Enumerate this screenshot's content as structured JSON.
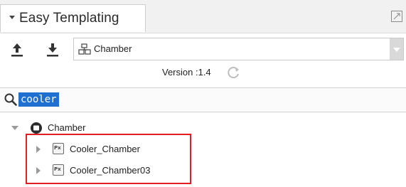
{
  "panel": {
    "tab_title": "Easy Templating"
  },
  "toolbar": {
    "selected_component": "Chamber"
  },
  "version": {
    "text": "Version :1.4"
  },
  "search": {
    "value": "cooler"
  },
  "tree": {
    "root": {
      "label": "Chamber",
      "expanded": true,
      "children": [
        {
          "label": "Cooler_Chamber"
        },
        {
          "label": "Cooler_Chamber03"
        }
      ]
    }
  },
  "colors": {
    "highlight": "#e41c24",
    "selection": "#1e6fd0"
  }
}
